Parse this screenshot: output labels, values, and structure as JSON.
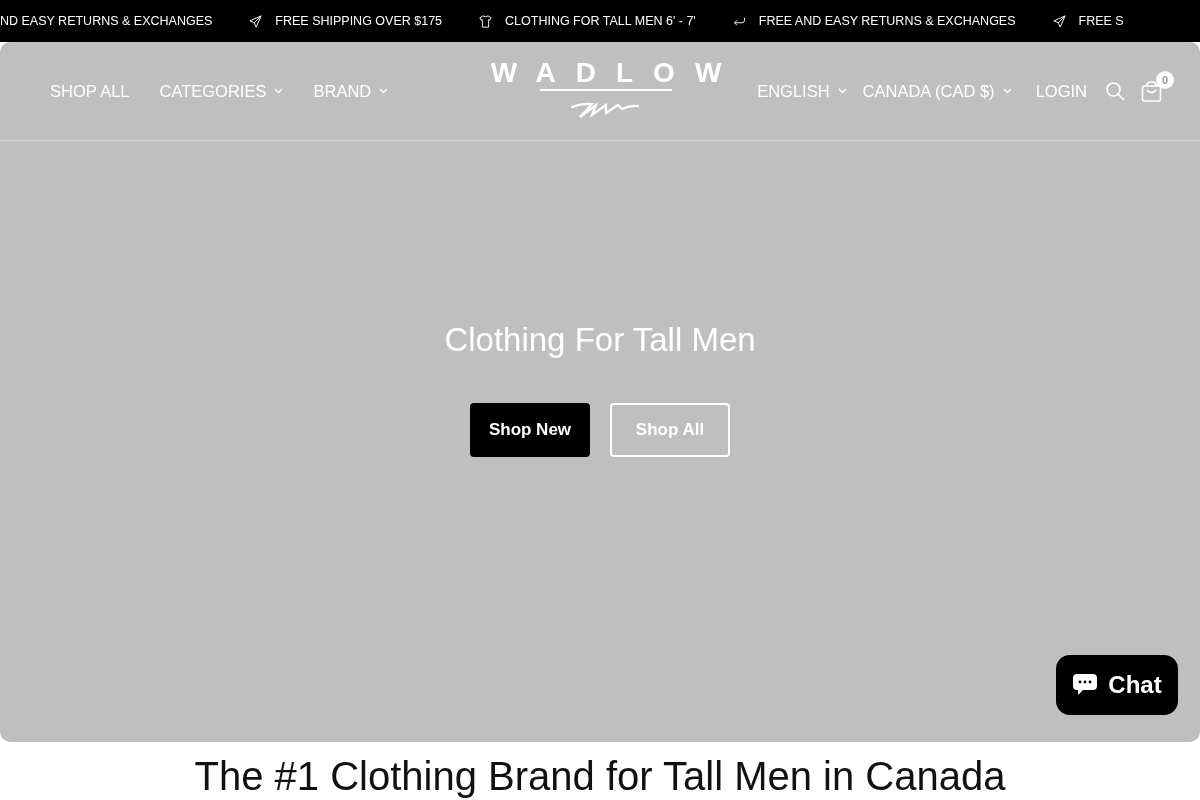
{
  "announcements": [
    {
      "kind": "cut",
      "text": "ND EASY RETURNS & EXCHANGES"
    },
    {
      "kind": "shipping",
      "text": "FREE SHIPPING OVER $175"
    },
    {
      "kind": "clothing",
      "text": "CLOTHING FOR TALL MEN 6' - 7'"
    },
    {
      "kind": "returns",
      "text": "FREE AND EASY RETURNS & EXCHANGES"
    },
    {
      "kind": "shipping",
      "text": "FREE S"
    }
  ],
  "header": {
    "nav_left": [
      {
        "label": "SHOP ALL",
        "dropdown": false
      },
      {
        "label": "CATEGORIES",
        "dropdown": true
      },
      {
        "label": "BRAND",
        "dropdown": true
      }
    ],
    "logo": "WADLOW",
    "nav_right": [
      {
        "label": "ENGLISH",
        "dropdown": true
      },
      {
        "label": "CANADA (CAD $)",
        "dropdown": true
      }
    ],
    "login": "LOGIN",
    "cart_count": "0"
  },
  "hero": {
    "title": "Clothing For Tall Men",
    "buttons": [
      {
        "label": "Shop New",
        "kind": "solid"
      },
      {
        "label": "Shop All",
        "kind": "outline"
      }
    ]
  },
  "chat": {
    "label": "Chat"
  },
  "section_heading": "The #1 Clothing Brand for Tall Men in Canada"
}
